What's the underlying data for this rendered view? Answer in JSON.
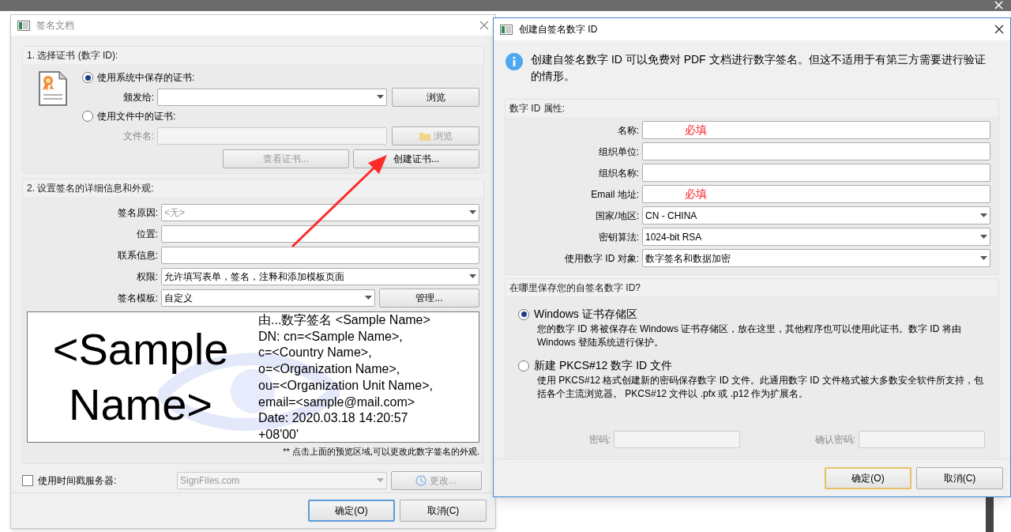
{
  "sign_dialog": {
    "title": "签名文档",
    "certificate": {
      "title": "1. 选择证书 (数字 ID):",
      "options": [
        {
          "label": "使用系统中保存的证书:",
          "selected": true,
          "field_label": "颁发给:",
          "kind": "dropdown",
          "field_disabled": false,
          "button": "浏览",
          "button_disabled": false,
          "button_icon": false
        },
        {
          "label": "使用文件中的证书:",
          "selected": false,
          "field_label": "文件名:",
          "kind": "text",
          "field_disabled": true,
          "button": "浏览",
          "button_disabled": true,
          "button_icon": true
        }
      ],
      "buttons": [
        {
          "label": "查看证书...",
          "disabled": true
        },
        {
          "label": "创建证书...",
          "disabled": false
        }
      ]
    },
    "details": {
      "title": "2. 设置签名的详细信息和外观:",
      "fields": [
        {
          "label": "签名原因:",
          "kind": "dropdown",
          "placeholder": "<无>"
        },
        {
          "label": "位置:",
          "kind": "text"
        },
        {
          "label": "联系信息:",
          "kind": "text"
        },
        {
          "label": "权限:",
          "kind": "dropdown",
          "value": "允许填写表单，签名，注释和添加模板页面"
        },
        {
          "label": "签名模板:",
          "kind": "dropdown",
          "value": "自定义",
          "button": "管理..."
        }
      ],
      "preview": {
        "name_lines": [
          "<Sample",
          "Name>"
        ],
        "lines": [
          "由...数字签名 <Sample Name>",
          "DN: cn=<Sample Name>,",
          "c=<Country Name>,",
          "o=<Organization Name>,",
          "ou=<Organization Unit Name>,",
          "email=<sample@mail.com>",
          "Date: 2020.03.18 14:20:57",
          "+08'00'"
        ]
      },
      "hint": "** 点击上面的预览区域,可以更改此数字签名的外观."
    },
    "timestamp": {
      "label": "使用时间戳服务器:",
      "checked": false,
      "server": "SignFiles.com",
      "button": "更改...",
      "disabled": true
    },
    "buttons": [
      {
        "label": "确定(O)",
        "default": true
      },
      {
        "label": "取消(C)",
        "default": false
      }
    ]
  },
  "create_id_dialog": {
    "title": "创建自签名数字 ID",
    "info": "创建自签名数字 ID 可以免费对 PDF 文档进行数字签名。但这不适用于有第三方需要进行验证的情形。",
    "properties": {
      "title": "数字 ID 属性:",
      "fields": [
        {
          "label": "名称:",
          "kind": "text",
          "note": "必填"
        },
        {
          "label": "组织单位:",
          "kind": "text"
        },
        {
          "label": "组织名称:",
          "kind": "text"
        },
        {
          "label": "Email 地址:",
          "kind": "text",
          "note": "必填"
        },
        {
          "label": "国家/地区:",
          "kind": "dropdown",
          "value": "CN - CHINA"
        },
        {
          "label": "密钥算法:",
          "kind": "dropdown",
          "value": "1024-bit RSA"
        },
        {
          "label": "使用数字 ID 对象:",
          "kind": "dropdown",
          "value": "数字签名和数据加密"
        }
      ]
    },
    "storage": {
      "title": "在哪里保存您的自签名数字 ID?",
      "options": [
        {
          "label": "Windows 证书存储区",
          "selected": true,
          "description": "您的数字 ID 将被保存在 Windows 证书存储区，放在这里，其他程序也可以使用此证书。数字 ID 将由 Windows 登陆系统进行保护。"
        },
        {
          "label": "新建 PKCS#12 数字 ID 文件",
          "selected": false,
          "description": "使用 PKCS#12 格式创建新的密码保存数字 ID 文件。此通用数字 ID 文件格式被大多数安全软件所支持，包括各个主流浏览器。 PKCS#12 文件以 .pfx 或 .p12 作为扩展名。"
        }
      ],
      "passwords": [
        {
          "label": "密码:",
          "disabled": true
        },
        {
          "label": "确认密码:",
          "disabled": true
        }
      ]
    },
    "buttons": [
      {
        "label": "确定(O)",
        "default": true
      },
      {
        "label": "取消(C)",
        "default": false
      }
    ]
  }
}
